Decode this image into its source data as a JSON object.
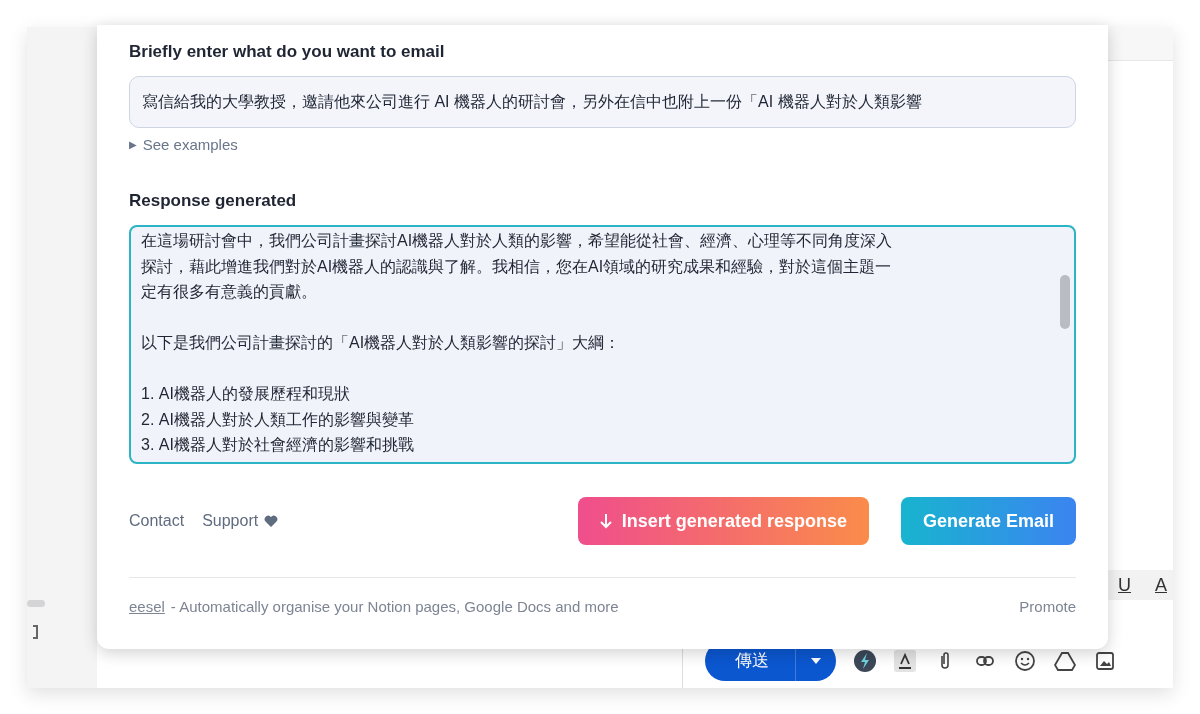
{
  "prompt": {
    "label": "Briefly enter what do you want to email",
    "value": "寫信給我的大學教授，邀請他來公司進行 AI 機器人的研討會，另外在信中也附上一份「AI 機器人對於人類影響",
    "toggle": "▶",
    "examples": "See examples"
  },
  "response": {
    "label": "Response generated",
    "paragraphs": [
      [
        "在這場研討會中，我們公司計畫探討AI機器人對於人類的影響，希望能從社會、經濟、心理等不同角度深入",
        "探討，藉此增進我們對於AI機器人的認識與了解。我相信，您在AI領域的研究成果和經驗，對於這個主題一",
        "定有很多有意義的貢獻。"
      ],
      [
        "以下是我們公司計畫探討的「AI機器人對於人類影響的探討」大綱："
      ],
      [
        "1. AI機器人的發展歷程和現狀",
        "2. AI機器人對於人類工作的影響與變革",
        "3. AI機器人對於社會經濟的影響和挑戰"
      ]
    ]
  },
  "links": [
    "Contact",
    "Support"
  ],
  "buttons": [
    {
      "kind": "insert",
      "label": "Insert generated response"
    },
    {
      "kind": "generate",
      "label": "Generate Email"
    }
  ],
  "footer": {
    "brand": "eesel",
    "tagline": "- Automatically organise your Notion pages, Google Docs and more",
    "promote": "Promote"
  },
  "compose": {
    "format_buttons": [
      "U",
      "A"
    ],
    "send_label": "傳送"
  }
}
